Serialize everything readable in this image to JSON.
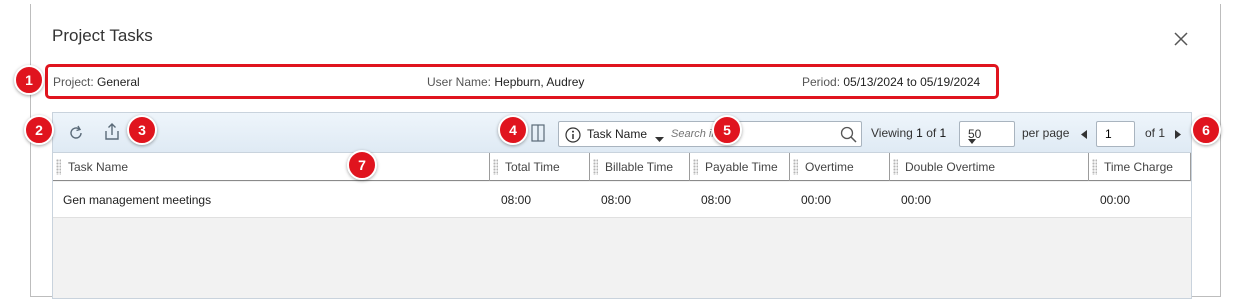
{
  "dialog": {
    "title": "Project Tasks"
  },
  "info": {
    "project_label": "Project:",
    "project_value": "General",
    "user_label": "User Name:",
    "user_value": "Hepburn, Audrey",
    "period_label": "Period:",
    "period_value": "05/13/2024 to 05/19/2024"
  },
  "badges": [
    "1",
    "2",
    "3",
    "4",
    "5",
    "6",
    "7"
  ],
  "toolbar": {
    "search_field": "Task Name",
    "search_placeholder": "Search in...",
    "viewing_label": "Viewing",
    "viewing_current": "1",
    "viewing_of": "of",
    "viewing_total": "1",
    "page_size": "50",
    "per_page_label": "per page",
    "page_input": "1",
    "of_pages": "of 1"
  },
  "table": {
    "columns": [
      "Task Name",
      "Total Time",
      "Billable Time",
      "Payable Time",
      "Overtime",
      "Double Overtime",
      "Time Charge"
    ],
    "rows": [
      [
        "Gen management meetings",
        "08:00",
        "08:00",
        "08:00",
        "00:00",
        "00:00",
        "00:00"
      ]
    ]
  },
  "colors": {
    "highlight": "#e0141e",
    "toolbar_bg": "#dfeaf4"
  },
  "icons": [
    "close-icon",
    "refresh-icon",
    "export-icon",
    "columns-icon",
    "info-icon",
    "caret-down-icon",
    "search-icon",
    "prev-page-icon",
    "next-page-icon"
  ]
}
